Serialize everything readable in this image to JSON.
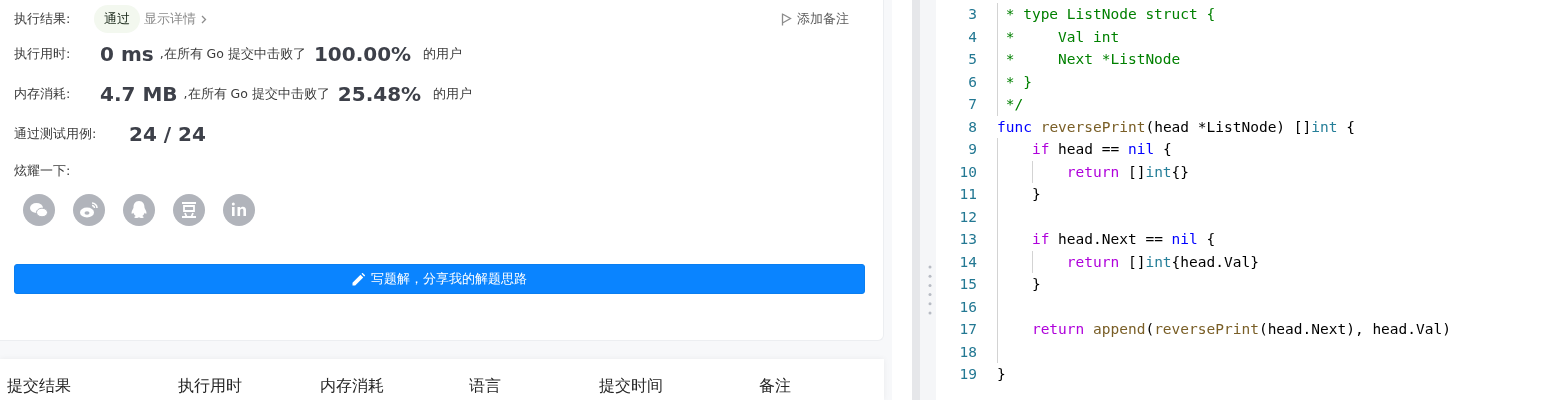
{
  "result": {
    "label": "执行结果:",
    "status": "通过",
    "details_link": "显示详情",
    "add_note": "添加备注"
  },
  "stats": [
    {
      "label": "执行用时:",
      "value": "0 ms",
      "text": ",在所有 Go 提交中击败了",
      "percent": "100.00%",
      "suffix": "的用户"
    },
    {
      "label": "内存消耗:",
      "value": "4.7 MB",
      "text": ",在所有 Go 提交中击败了",
      "percent": "25.48%",
      "suffix": "的用户"
    }
  ],
  "tests": {
    "label": "通过测试用例:",
    "value": "24 / 24"
  },
  "share": {
    "label": "炫耀一下:"
  },
  "write_button": "写题解，分享我的解题思路",
  "table": {
    "columns": [
      "提交结果",
      "执行用时",
      "内存消耗",
      "语言",
      "提交时间",
      "备注"
    ]
  },
  "editor": {
    "lines": [
      {
        "number": "3",
        "tokens": [
          {
            "kind": "comment",
            "text": " * type ListNode struct {"
          }
        ]
      },
      {
        "number": "4",
        "tokens": [
          {
            "kind": "comment",
            "text": " *     Val int"
          }
        ]
      },
      {
        "number": "5",
        "tokens": [
          {
            "kind": "comment",
            "text": " *     Next *ListNode"
          }
        ]
      },
      {
        "number": "6",
        "tokens": [
          {
            "kind": "comment",
            "text": " * }"
          }
        ]
      },
      {
        "number": "7",
        "tokens": [
          {
            "kind": "comment",
            "text": " */"
          }
        ]
      },
      {
        "number": "8",
        "tokens": [
          {
            "kind": "keyword",
            "text": "func"
          },
          {
            "kind": "function",
            "text": " reversePrint"
          },
          {
            "kind": "plain",
            "text": "(head *ListNode) []"
          },
          {
            "kind": "type",
            "text": "int"
          },
          {
            "kind": "plain",
            "text": " {"
          }
        ]
      },
      {
        "number": "9",
        "tokens": [
          {
            "kind": "control",
            "text": "    if"
          },
          {
            "kind": "plain",
            "text": " head == "
          },
          {
            "kind": "constant",
            "text": "nil"
          },
          {
            "kind": "plain",
            "text": " {"
          }
        ]
      },
      {
        "number": "10",
        "tokens": [
          {
            "kind": "control",
            "text": "        return"
          },
          {
            "kind": "plain",
            "text": " []"
          },
          {
            "kind": "type",
            "text": "int"
          },
          {
            "kind": "plain",
            "text": "{}"
          }
        ]
      },
      {
        "number": "11",
        "tokens": [
          {
            "kind": "plain",
            "text": "    }"
          }
        ]
      },
      {
        "number": "12"
      },
      {
        "number": "13",
        "tokens": [
          {
            "kind": "control",
            "text": "    if"
          },
          {
            "kind": "plain",
            "text": " head.Next == "
          },
          {
            "kind": "constant",
            "text": "nil"
          },
          {
            "kind": "plain",
            "text": " {"
          }
        ]
      },
      {
        "number": "14",
        "tokens": [
          {
            "kind": "control",
            "text": "        return"
          },
          {
            "kind": "plain",
            "text": " []"
          },
          {
            "kind": "type",
            "text": "int"
          },
          {
            "kind": "plain",
            "text": "{head.Val}"
          }
        ]
      },
      {
        "number": "15",
        "tokens": [
          {
            "kind": "plain",
            "text": "    }"
          }
        ]
      },
      {
        "number": "16"
      },
      {
        "number": "17",
        "tokens": [
          {
            "kind": "control",
            "text": "    return"
          },
          {
            "kind": "function",
            "text": " append"
          },
          {
            "kind": "plain",
            "text": "("
          },
          {
            "kind": "function",
            "text": "reversePrint"
          },
          {
            "kind": "plain",
            "text": "(head.Next), head.Val)"
          }
        ]
      },
      {
        "number": "18"
      },
      {
        "number": "19",
        "tokens": [
          {
            "kind": "plain",
            "text": "}"
          }
        ]
      }
    ]
  }
}
